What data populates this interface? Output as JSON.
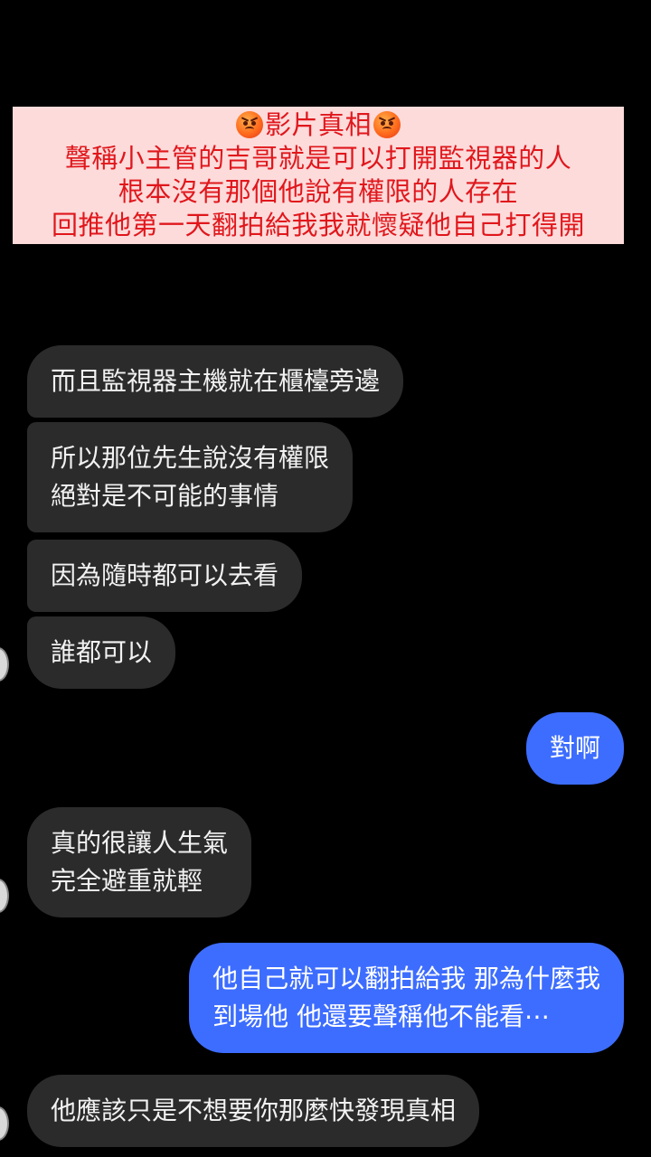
{
  "banner": {
    "title": "影片真相",
    "line2": "聲稱小主管的吉哥就是可以打開監視器的人",
    "line3": "根本沒有那個他說有權限的人存在",
    "line4": "回推他第一天翻拍給我我就懷疑他自己打得開",
    "emoji_icon": "angry-face-icon",
    "text_color": "#e0171c",
    "background_color": "#fddbdb"
  },
  "messages": [
    {
      "side": "incoming",
      "lines": [
        "而且監視器主機就在櫃檯旁邊"
      ]
    },
    {
      "side": "incoming",
      "lines": [
        "所以那位先生說沒有權限",
        "絕對是不可能的事情"
      ]
    },
    {
      "side": "incoming",
      "lines": [
        "因為隨時都可以去看"
      ]
    },
    {
      "side": "incoming",
      "lines": [
        "誰都可以"
      ]
    },
    {
      "side": "outgoing",
      "lines": [
        "對啊"
      ]
    },
    {
      "side": "incoming",
      "lines": [
        "真的很讓人生氣",
        "完全避重就輕"
      ]
    },
    {
      "side": "outgoing",
      "lines": [
        "他自己就可以翻拍給我 那為什麼我",
        "到場他 他還要聲稱他不能看⋯"
      ]
    },
    {
      "side": "incoming",
      "lines": [
        "他應該只是不想要你那麼快發現真相"
      ]
    }
  ],
  "colors": {
    "background": "#000000",
    "incoming_bubble": "#2b2b2b",
    "outgoing_bubble": "#3d6dff",
    "incoming_text": "#f2f2f2",
    "outgoing_text": "#ffffff"
  }
}
